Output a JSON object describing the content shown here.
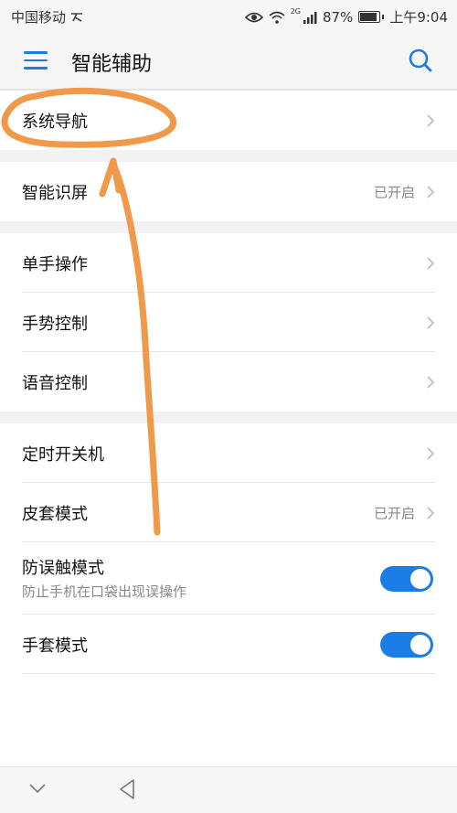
{
  "status_bar": {
    "carrier": "中国移动",
    "network_label": "2G",
    "battery": "87%",
    "battery_level": 0.87,
    "time": "上午9:04"
  },
  "header": {
    "title": "智能辅助",
    "menu_icon": "hamburger-menu-icon",
    "search_icon": "search-icon"
  },
  "groups": [
    {
      "items": [
        {
          "label": "系统导航"
        }
      ]
    },
    {
      "items": [
        {
          "label": "智能识屏",
          "value": "已开启"
        }
      ]
    },
    {
      "items": [
        {
          "label": "单手操作"
        },
        {
          "label": "手势控制"
        },
        {
          "label": "语音控制"
        }
      ]
    },
    {
      "items": [
        {
          "label": "定时开关机"
        },
        {
          "label": "皮套模式",
          "value": "已开启"
        },
        {
          "label": "防误触模式",
          "sublabel": "防止手机在口袋出现误操作",
          "toggle": true
        },
        {
          "label": "手套模式",
          "toggle": true
        }
      ]
    }
  ],
  "colors": {
    "accent": "#1a7ee6",
    "annotation": "#f0994a"
  }
}
